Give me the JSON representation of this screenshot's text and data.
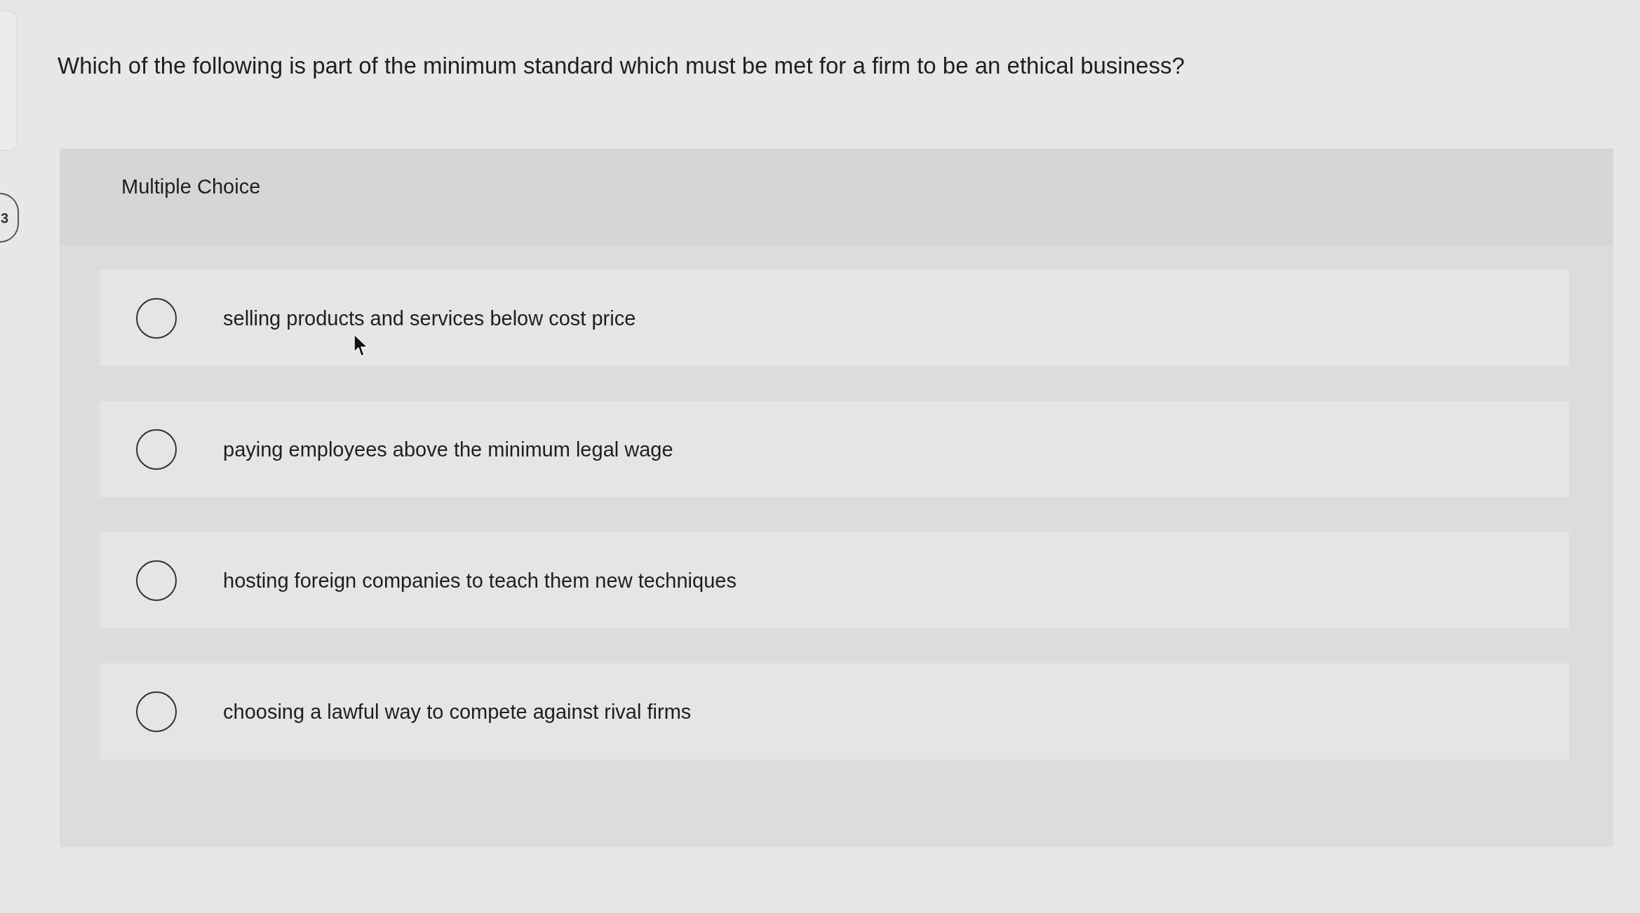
{
  "question": {
    "number": "3",
    "text": "Which of the following is part of the minimum standard which must be met for a firm to be an ethical business?"
  },
  "answer_panel": {
    "heading": "Multiple Choice",
    "options": [
      {
        "label": "selling products and services below cost price",
        "selected": false
      },
      {
        "label": "paying employees above the minimum legal wage",
        "selected": false
      },
      {
        "label": "hosting foreign companies to teach them new techniques",
        "selected": false
      },
      {
        "label": "choosing a lawful way to compete against rival firms",
        "selected": false
      }
    ]
  }
}
